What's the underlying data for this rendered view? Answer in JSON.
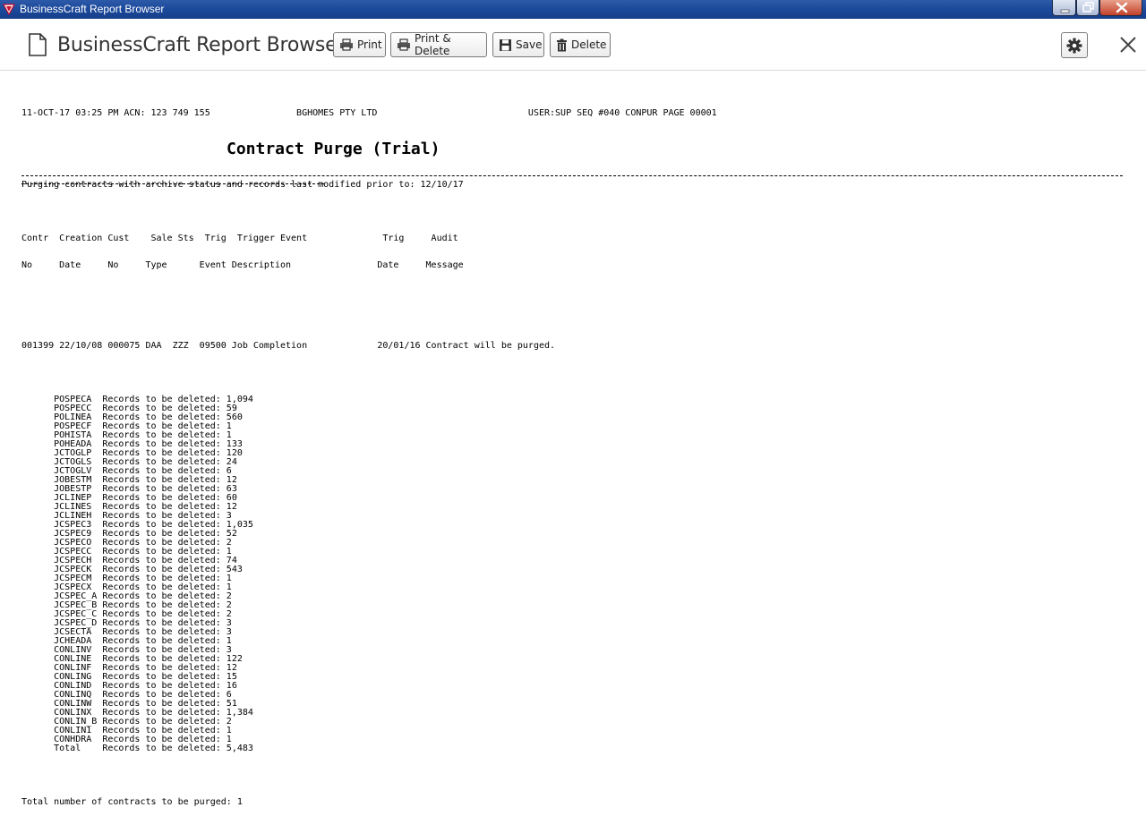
{
  "window": {
    "title": "BusinessCraft Report Browser"
  },
  "header": {
    "title": "BusinessCraft Report Browser",
    "buttons": {
      "print": "Print",
      "print_delete": "Print & Delete",
      "save": "Save",
      "delete": "Delete"
    }
  },
  "report": {
    "header_line": "11-OCT-17 03:25 PM ACN: 123 749 155                BGHOMES PTY LTD                            USER:SUP SEQ #040 CONPUR PAGE 00001",
    "title": "Contract Purge (Trial)",
    "criteria": "Purging contracts with archive status and records last modified prior to: 12/10/17",
    "column_header_1": "Contr  Creation Cust    Sale Sts  Trig  Trigger Event              Trig     Audit",
    "column_header_2": "No     Date     No     Type      Event Description                Date     Message",
    "contract_line": "001399 22/10/08 000075 DAA  ZZZ  09500 Job Completion             20/01/16 Contract will be purged.",
    "details": [
      {
        "table": "POSPECA",
        "count": "1,094"
      },
      {
        "table": "POSPECC",
        "count": "59"
      },
      {
        "table": "POLINEA",
        "count": "560"
      },
      {
        "table": "POSPECF",
        "count": "1"
      },
      {
        "table": "POHISTA",
        "count": "1"
      },
      {
        "table": "POHEADA",
        "count": "133"
      },
      {
        "table": "JCTOGLP",
        "count": "120"
      },
      {
        "table": "JCTOGLS",
        "count": "24"
      },
      {
        "table": "JCTOGLV",
        "count": "6"
      },
      {
        "table": "JOBESTM",
        "count": "12"
      },
      {
        "table": "JOBESTP",
        "count": "63"
      },
      {
        "table": "JCLINEP",
        "count": "60"
      },
      {
        "table": "JCLINES",
        "count": "12"
      },
      {
        "table": "JCLINEH",
        "count": "3"
      },
      {
        "table": "JCSPEC3",
        "count": "1,035"
      },
      {
        "table": "JCSPEC9",
        "count": "52"
      },
      {
        "table": "JCSPECO",
        "count": "2"
      },
      {
        "table": "JCSPECC",
        "count": "1"
      },
      {
        "table": "JCSPECH",
        "count": "74"
      },
      {
        "table": "JCSPECK",
        "count": "543"
      },
      {
        "table": "JCSPECM",
        "count": "1"
      },
      {
        "table": "JCSPECX",
        "count": "1"
      },
      {
        "table": "JCSPEC_A",
        "count": "2"
      },
      {
        "table": "JCSPEC_B",
        "count": "2"
      },
      {
        "table": "JCSPEC_C",
        "count": "2"
      },
      {
        "table": "JCSPEC_D",
        "count": "3"
      },
      {
        "table": "JCSECTA",
        "count": "3"
      },
      {
        "table": "JCHEADA",
        "count": "1"
      },
      {
        "table": "CONLINV",
        "count": "3"
      },
      {
        "table": "CONLINE",
        "count": "122"
      },
      {
        "table": "CONLINF",
        "count": "12"
      },
      {
        "table": "CONLING",
        "count": "15"
      },
      {
        "table": "CONLIND",
        "count": "16"
      },
      {
        "table": "CONLINQ",
        "count": "6"
      },
      {
        "table": "CONLINW",
        "count": "51"
      },
      {
        "table": "CONLINX",
        "count": "1,384"
      },
      {
        "table": "CONLIN_B",
        "count": "2"
      },
      {
        "table": "CONLIN1",
        "count": "1"
      },
      {
        "table": "CONHDRA",
        "count": "1"
      },
      {
        "table": "Total",
        "count": "5,483"
      }
    ],
    "records_label": "Records to be deleted: ",
    "footer": "Total number of contracts to be purged: 1"
  }
}
